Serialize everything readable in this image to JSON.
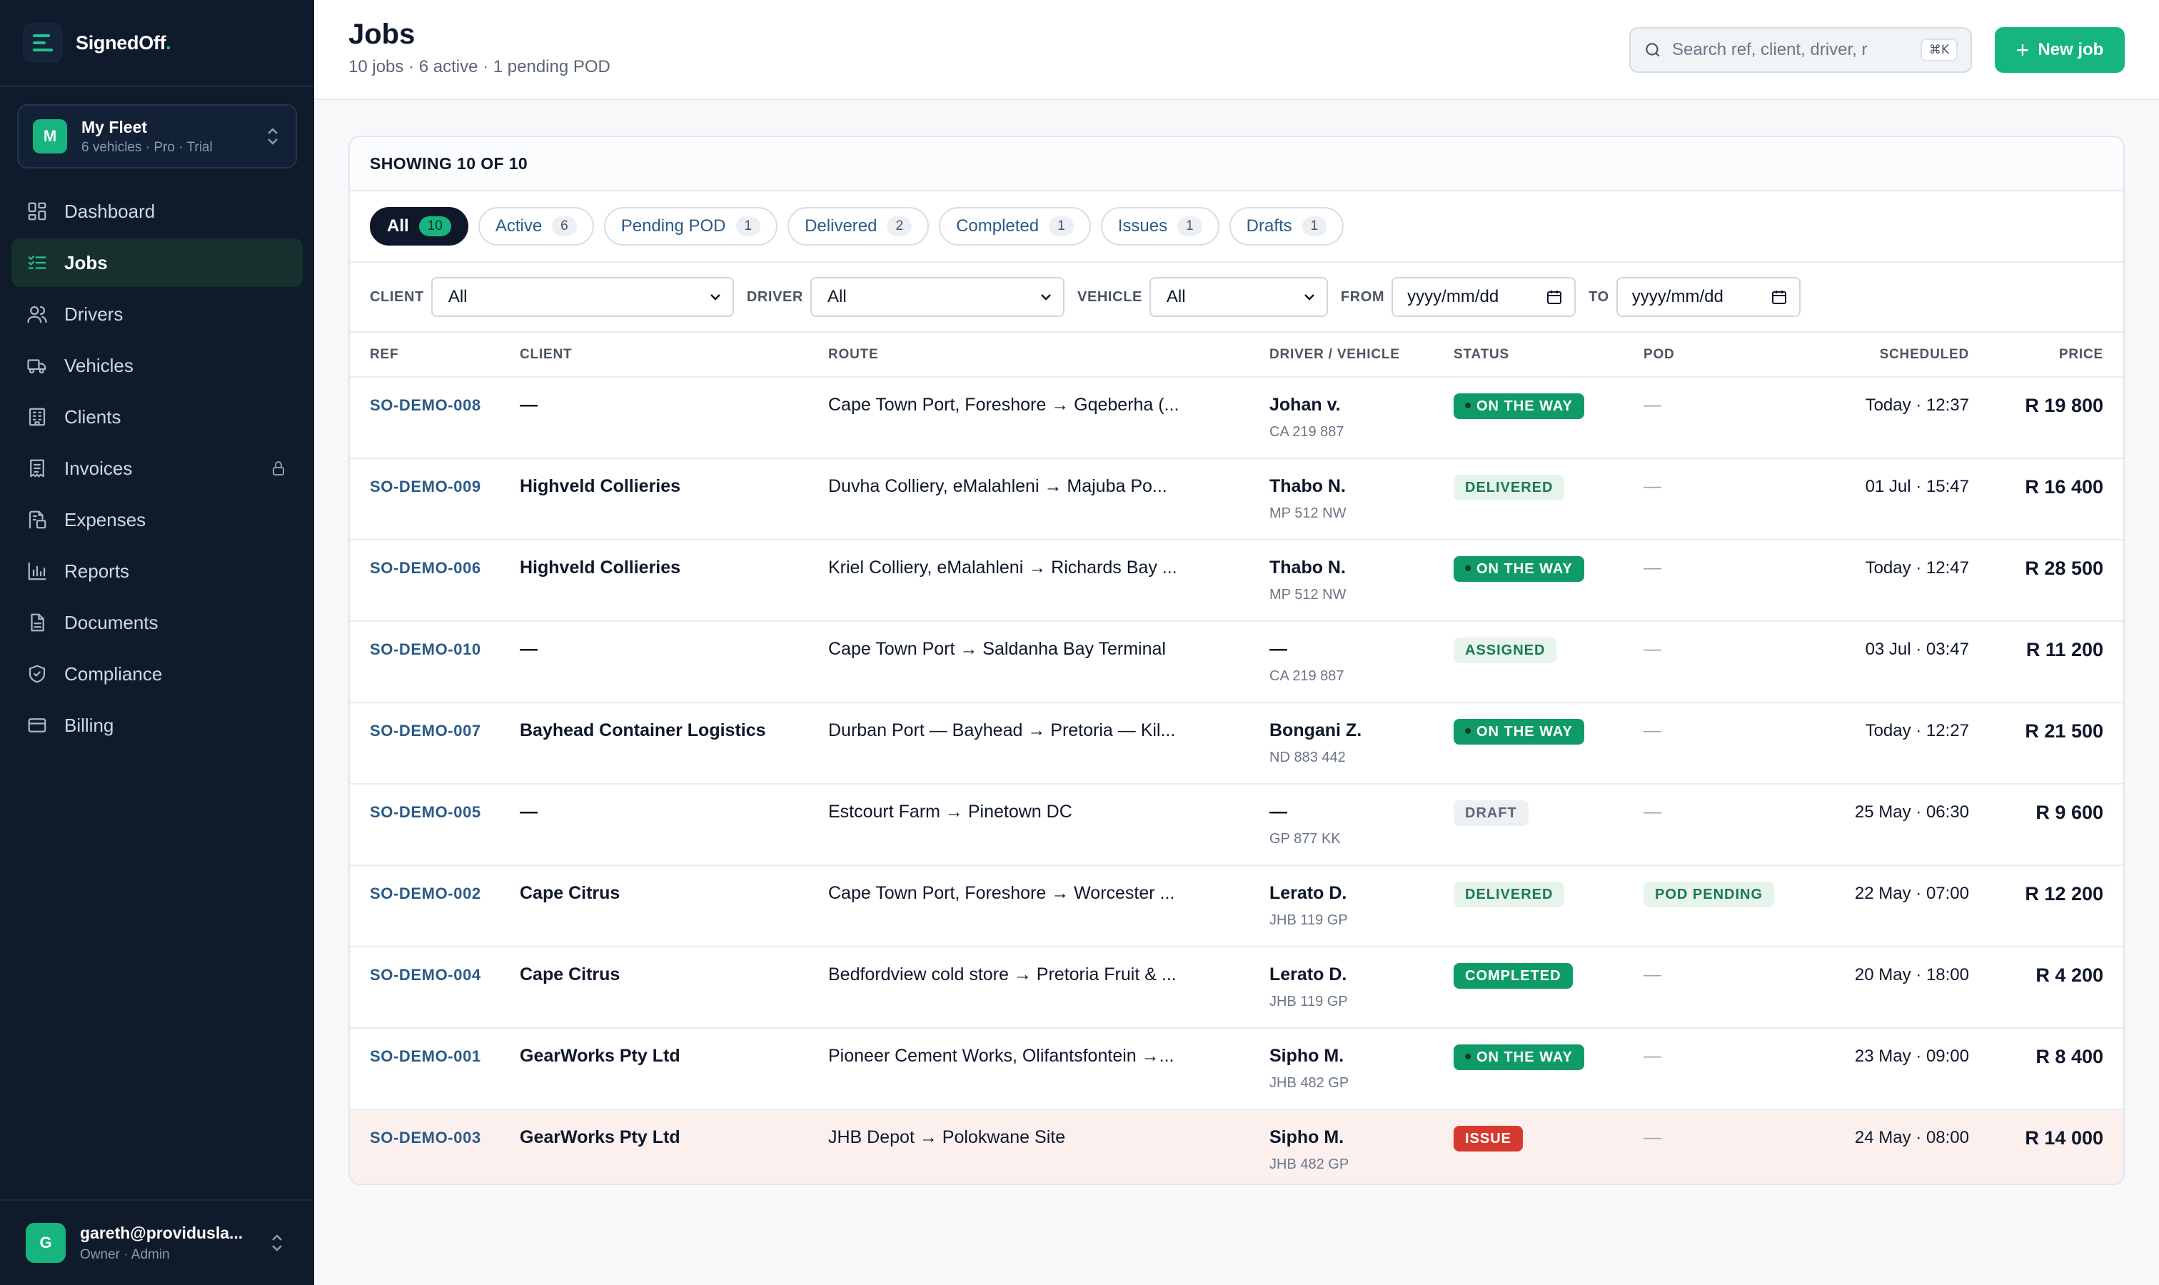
{
  "brand": {
    "name": "SignedOff",
    "dot": "."
  },
  "fleet": {
    "initial": "M",
    "name": "My Fleet",
    "sub": "6 vehicles · Pro · Trial"
  },
  "nav": [
    {
      "label": "Dashboard",
      "icon": "dashboard-icon"
    },
    {
      "label": "Jobs",
      "icon": "jobs-icon",
      "active": true
    },
    {
      "label": "Drivers",
      "icon": "drivers-icon"
    },
    {
      "label": "Vehicles",
      "icon": "vehicles-icon"
    },
    {
      "label": "Clients",
      "icon": "clients-icon"
    },
    {
      "label": "Invoices",
      "icon": "invoices-icon",
      "locked": true
    },
    {
      "label": "Expenses",
      "icon": "expenses-icon"
    },
    {
      "label": "Reports",
      "icon": "reports-icon"
    },
    {
      "label": "Documents",
      "icon": "documents-icon"
    },
    {
      "label": "Compliance",
      "icon": "compliance-icon"
    },
    {
      "label": "Billing",
      "icon": "billing-icon"
    }
  ],
  "user": {
    "initial": "G",
    "email": "gareth@providusla...",
    "role": "Owner · Admin"
  },
  "header": {
    "title": "Jobs",
    "subtitle": "10 jobs · 6 active · 1 pending POD",
    "search_placeholder": "Search ref, client, driver, r",
    "search_shortcut": "⌘K",
    "new_job_label": "New job"
  },
  "card": {
    "showing": "SHOWING 10 OF 10"
  },
  "tabs": [
    {
      "label": "All",
      "count": "10",
      "active": true
    },
    {
      "label": "Active",
      "count": "6"
    },
    {
      "label": "Pending POD",
      "count": "1"
    },
    {
      "label": "Delivered",
      "count": "2"
    },
    {
      "label": "Completed",
      "count": "1"
    },
    {
      "label": "Issues",
      "count": "1"
    },
    {
      "label": "Drafts",
      "count": "1"
    }
  ],
  "filters": {
    "client_label": "CLIENT",
    "client_value": "All",
    "driver_label": "DRIVER",
    "driver_value": "All",
    "vehicle_label": "VEHICLE",
    "vehicle_value": "All",
    "from_label": "FROM",
    "from_placeholder": "yyyy/mm/dd",
    "to_label": "TO",
    "to_placeholder": "yyyy/mm/dd"
  },
  "columns": {
    "ref": "REF",
    "client": "CLIENT",
    "route": "ROUTE",
    "driver": "DRIVER / VEHICLE",
    "status": "STATUS",
    "pod": "POD",
    "scheduled": "SCHEDULED",
    "price": "PRICE"
  },
  "status_colors": {
    "on_the_way": "#0f9b68",
    "delivered": "#e6f4ec",
    "completed": "#0f9b68",
    "issue": "#d63a2f",
    "draft": "#eef1f4",
    "brand": "#16b57f"
  },
  "jobs": [
    {
      "ref": "SO-DEMO-008",
      "client": "—",
      "route": "Cape Town Port, Foreshore → Gqeberha (...",
      "driver": "Johan v.",
      "reg": "CA 219 887",
      "status": "ON THE WAY",
      "status_kind": "onway",
      "pod": "—",
      "scheduled": "Today · 12:37",
      "price": "R 19 800"
    },
    {
      "ref": "SO-DEMO-009",
      "client": "Highveld Collieries",
      "route": "Duvha Colliery, eMalahleni → Majuba Po...",
      "driver": "Thabo N.",
      "reg": "MP 512 NW",
      "status": "DELIVERED",
      "status_kind": "delivered",
      "pod": "—",
      "scheduled": "01 Jul · 15:47",
      "price": "R 16 400"
    },
    {
      "ref": "SO-DEMO-006",
      "client": "Highveld Collieries",
      "route": "Kriel Colliery, eMalahleni → Richards Bay ...",
      "driver": "Thabo N.",
      "reg": "MP 512 NW",
      "status": "ON THE WAY",
      "status_kind": "onway",
      "pod": "—",
      "scheduled": "Today · 12:47",
      "price": "R 28 500"
    },
    {
      "ref": "SO-DEMO-010",
      "client": "—",
      "route": "Cape Town Port → Saldanha Bay Terminal",
      "driver": "—",
      "reg": "CA 219 887",
      "status": "ASSIGNED",
      "status_kind": "assigned",
      "pod": "—",
      "scheduled": "03 Jul · 03:47",
      "price": "R 11 200"
    },
    {
      "ref": "SO-DEMO-007",
      "client": "Bayhead Container Logistics",
      "route": "Durban Port — Bayhead → Pretoria — Kil...",
      "driver": "Bongani Z.",
      "reg": "ND 883 442",
      "status": "ON THE WAY",
      "status_kind": "onway",
      "pod": "—",
      "scheduled": "Today · 12:27",
      "price": "R 21 500"
    },
    {
      "ref": "SO-DEMO-005",
      "client": "—",
      "route": "Estcourt Farm → Pinetown DC",
      "driver": "—",
      "reg": "GP 877 KK",
      "status": "DRAFT",
      "status_kind": "draft",
      "pod": "—",
      "scheduled": "25 May · 06:30",
      "price": "R 9 600"
    },
    {
      "ref": "SO-DEMO-002",
      "client": "Cape Citrus",
      "route": "Cape Town Port, Foreshore → Worcester ...",
      "driver": "Lerato D.",
      "reg": "JHB 119 GP",
      "status": "DELIVERED",
      "status_kind": "delivered",
      "pod": "POD PENDING",
      "pod_badge": true,
      "scheduled": "22 May · 07:00",
      "price": "R 12 200"
    },
    {
      "ref": "SO-DEMO-004",
      "client": "Cape Citrus",
      "route": "Bedfordview cold store → Pretoria Fruit & ...",
      "driver": "Lerato D.",
      "reg": "JHB 119 GP",
      "status": "COMPLETED",
      "status_kind": "completed",
      "pod": "—",
      "scheduled": "20 May · 18:00",
      "price": "R 4 200"
    },
    {
      "ref": "SO-DEMO-001",
      "client": "GearWorks Pty Ltd",
      "route": "Pioneer Cement Works, Olifantsfontein →...",
      "driver": "Sipho M.",
      "reg": "JHB 482 GP",
      "status": "ON THE WAY",
      "status_kind": "onway",
      "pod": "—",
      "scheduled": "23 May · 09:00",
      "price": "R 8 400"
    },
    {
      "ref": "SO-DEMO-003",
      "client": "GearWorks Pty Ltd",
      "route": "JHB Depot → Polokwane Site",
      "driver": "Sipho M.",
      "reg": "JHB 482 GP",
      "status": "ISSUE",
      "status_kind": "issue",
      "pod": "—",
      "scheduled": "24 May · 08:00",
      "price": "R 14 000",
      "highlight": true
    }
  ]
}
